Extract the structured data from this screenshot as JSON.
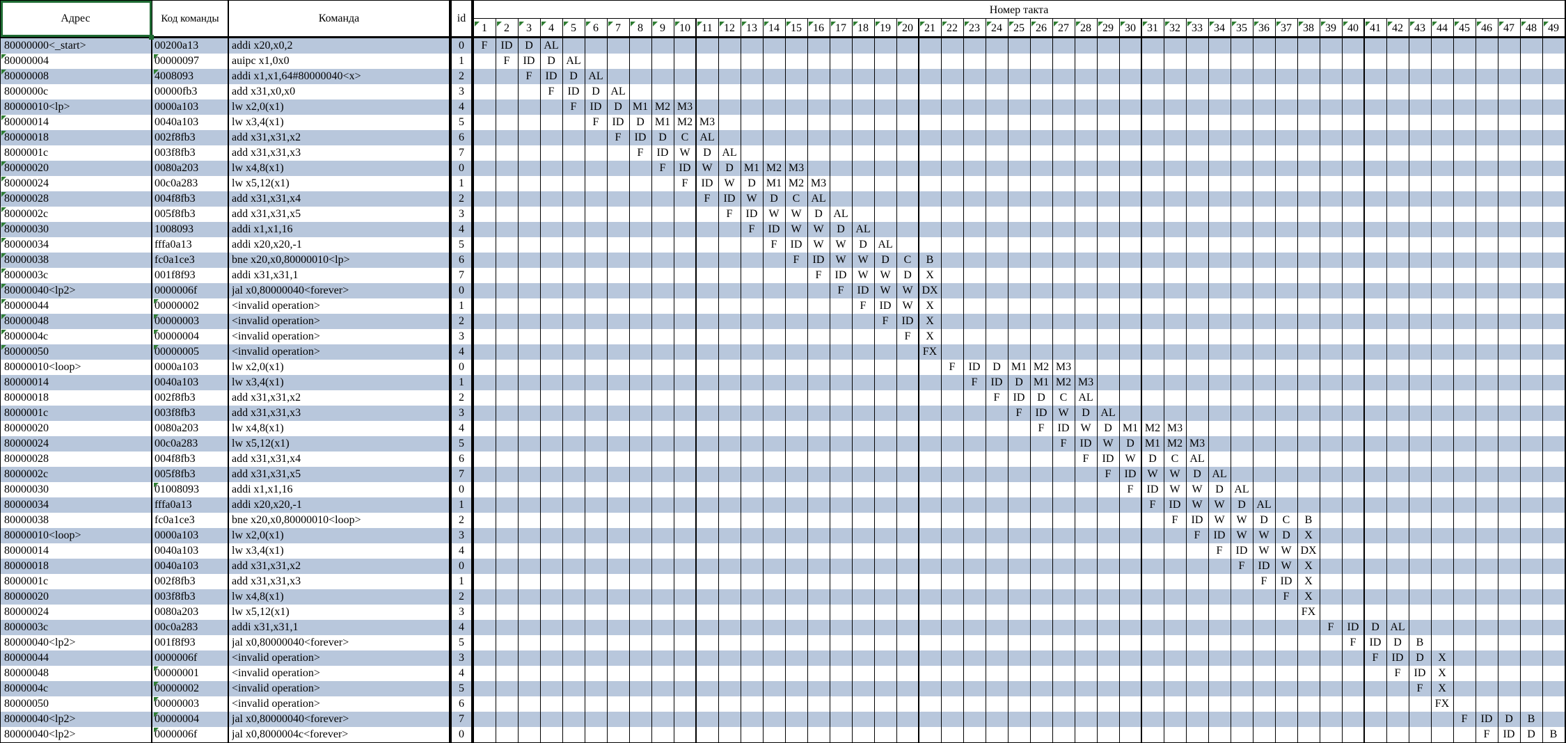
{
  "headers": {
    "address": "Адрес",
    "code": "Код команды",
    "command": "Команда",
    "id": "id",
    "clock": "Номер такта"
  },
  "cycles": [
    "1",
    "2",
    "3",
    "4",
    "5",
    "6",
    "7",
    "8",
    "9",
    "10",
    "11",
    "12",
    "13",
    "14",
    "15",
    "16",
    "17",
    "18",
    "19",
    "20",
    "21",
    "22",
    "23",
    "24",
    "25",
    "26",
    "27",
    "28",
    "29",
    "30",
    "31",
    "32",
    "33",
    "34",
    "35",
    "36",
    "37",
    "38",
    "39",
    "40",
    "41",
    "42",
    "43",
    "44",
    "45",
    "46",
    "47",
    "48",
    "49"
  ],
  "colors": {
    "band": "#b8c7dc",
    "grid_line": "#000000",
    "comment_marker": "#2e7d32",
    "selection": "#1f6b33"
  },
  "rows": [
    {
      "addr": "80000000<_start>",
      "code": "00200a13",
      "cmd": "addi x20,x0,2",
      "id": "0",
      "start": 1,
      "stages": [
        "F",
        "ID",
        "D",
        "AL"
      ]
    },
    {
      "addr": "80000004",
      "code": "00000097",
      "cmd": "auipc x1,0x0",
      "id": "1",
      "start": 2,
      "stages": [
        "F",
        "ID",
        "D",
        "AL"
      ]
    },
    {
      "addr": "80000008",
      "code": "4008093",
      "cmd": "addi x1,x1,64#80000040<x>",
      "id": "2",
      "start": 3,
      "stages": [
        "F",
        "ID",
        "D",
        "AL"
      ]
    },
    {
      "addr": "8000000c",
      "code": "00000fb3",
      "cmd": "add x31,x0,x0",
      "id": "3",
      "start": 4,
      "stages": [
        "F",
        "ID",
        "D",
        "AL"
      ]
    },
    {
      "addr": "80000010<lp>",
      "code": "0000a103",
      "cmd": "lw x2,0(x1)",
      "id": "4",
      "start": 5,
      "stages": [
        "F",
        "ID",
        "D",
        "M1",
        "M2",
        "M3"
      ]
    },
    {
      "addr": "80000014",
      "code": "0040a103",
      "cmd": "lw x3,4(x1)",
      "id": "5",
      "start": 6,
      "stages": [
        "F",
        "ID",
        "D",
        "M1",
        "M2",
        "M3"
      ]
    },
    {
      "addr": "80000018",
      "code": "002f8fb3",
      "cmd": "add x31,x31,x2",
      "id": "6",
      "start": 7,
      "stages": [
        "F",
        "ID",
        "D",
        "C",
        "AL"
      ]
    },
    {
      "addr": "8000001c",
      "code": "003f8fb3",
      "cmd": "add x31,x31,x3",
      "id": "7",
      "start": 8,
      "stages": [
        "F",
        "ID",
        "W",
        "D",
        "AL"
      ]
    },
    {
      "addr": "80000020",
      "code": "0080a203",
      "cmd": "lw x4,8(x1)",
      "id": "0",
      "start": 9,
      "stages": [
        "F",
        "ID",
        "W",
        "D",
        "M1",
        "M2",
        "M3"
      ]
    },
    {
      "addr": "80000024",
      "code": "00c0a283",
      "cmd": "lw x5,12(x1)",
      "id": "1",
      "start": 10,
      "stages": [
        "F",
        "ID",
        "W",
        "D",
        "M1",
        "M2",
        "M3"
      ]
    },
    {
      "addr": "80000028",
      "code": "004f8fb3",
      "cmd": "add x31,x31,x4",
      "id": "2",
      "start": 11,
      "stages": [
        "F",
        "ID",
        "W",
        "D",
        "C",
        "AL"
      ]
    },
    {
      "addr": "8000002c",
      "code": "005f8fb3",
      "cmd": "add x31,x31,x5",
      "id": "3",
      "start": 12,
      "stages": [
        "F",
        "ID",
        "W",
        "W",
        "D",
        "AL"
      ]
    },
    {
      "addr": "80000030",
      "code": "1008093",
      "cmd": "addi x1,x1,16",
      "id": "4",
      "start": 13,
      "stages": [
        "F",
        "ID",
        "W",
        "W",
        "D",
        "AL"
      ]
    },
    {
      "addr": "80000034",
      "code": "fffa0a13",
      "cmd": "addi x20,x20,-1",
      "id": "5",
      "start": 14,
      "stages": [
        "F",
        "ID",
        "W",
        "W",
        "D",
        "AL"
      ]
    },
    {
      "addr": "80000038",
      "code": "fc0a1ce3",
      "cmd": "bne x20,x0,80000010<lp>",
      "id": "6",
      "start": 15,
      "stages": [
        "F",
        "ID",
        "W",
        "W",
        "D",
        "C",
        "B"
      ]
    },
    {
      "addr": "8000003c",
      "code": "001f8f93",
      "cmd": "addi x31,x31,1",
      "id": "7",
      "start": 16,
      "stages": [
        "F",
        "ID",
        "W",
        "W",
        "D",
        "X"
      ]
    },
    {
      "addr": "80000040<lp2>",
      "code": "0000006f",
      "cmd": "jal x0,80000040<forever>",
      "id": "0",
      "start": 17,
      "stages": [
        "F",
        "ID",
        "W",
        "W",
        "DX"
      ]
    },
    {
      "addr": "80000044",
      "code": "00000002",
      "cmd": "<invalid operation>",
      "id": "1",
      "start": 18,
      "stages": [
        "F",
        "ID",
        "W",
        "X"
      ]
    },
    {
      "addr": "80000048",
      "code": "00000003",
      "cmd": "<invalid operation>",
      "id": "2",
      "start": 19,
      "stages": [
        "F",
        "ID",
        "X"
      ]
    },
    {
      "addr": "8000004c",
      "code": "00000004",
      "cmd": "<invalid operation>",
      "id": "3",
      "start": 20,
      "stages": [
        "F",
        "X"
      ]
    },
    {
      "addr": "80000050",
      "code": "00000005",
      "cmd": "<invalid operation>",
      "id": "4",
      "start": 21,
      "stages": [
        "FX"
      ]
    },
    {
      "addr": "80000010<loop>",
      "code": "0000a103",
      "cmd": "lw x2,0(x1)",
      "id": "0",
      "start": 22,
      "stages": [
        "F",
        "ID",
        "D",
        "M1",
        "M2",
        "M3"
      ]
    },
    {
      "addr": "80000014",
      "code": "0040a103",
      "cmd": "lw x3,4(x1)",
      "id": "1",
      "start": 23,
      "stages": [
        "F",
        "ID",
        "D",
        "M1",
        "M2",
        "M3"
      ]
    },
    {
      "addr": "80000018",
      "code": "002f8fb3",
      "cmd": "add x31,x31,x2",
      "id": "2",
      "start": 24,
      "stages": [
        "F",
        "ID",
        "D",
        "C",
        "AL"
      ]
    },
    {
      "addr": "8000001c",
      "code": "003f8fb3",
      "cmd": "add x31,x31,x3",
      "id": "3",
      "start": 25,
      "stages": [
        "F",
        "ID",
        "W",
        "D",
        "AL"
      ]
    },
    {
      "addr": "80000020",
      "code": "0080a203",
      "cmd": "lw x4,8(x1)",
      "id": "4",
      "start": 26,
      "stages": [
        "F",
        "ID",
        "W",
        "D",
        "M1",
        "M2",
        "M3"
      ]
    },
    {
      "addr": "80000024",
      "code": "00c0a283",
      "cmd": "lw x5,12(x1)",
      "id": "5",
      "start": 27,
      "stages": [
        "F",
        "ID",
        "W",
        "D",
        "M1",
        "M2",
        "M3"
      ]
    },
    {
      "addr": "80000028",
      "code": "004f8fb3",
      "cmd": "add x31,x31,x4",
      "id": "6",
      "start": 28,
      "stages": [
        "F",
        "ID",
        "W",
        "D",
        "C",
        "AL"
      ]
    },
    {
      "addr": "8000002c",
      "code": "005f8fb3",
      "cmd": "add x31,x31,x5",
      "id": "7",
      "start": 29,
      "stages": [
        "F",
        "ID",
        "W",
        "W",
        "D",
        "AL"
      ]
    },
    {
      "addr": "80000030",
      "code": "01008093",
      "cmd": "addi x1,x1,16",
      "id": "0",
      "start": 30,
      "stages": [
        "F",
        "ID",
        "W",
        "W",
        "D",
        "AL"
      ]
    },
    {
      "addr": "80000034",
      "code": "fffa0a13",
      "cmd": "addi x20,x20,-1",
      "id": "1",
      "start": 31,
      "stages": [
        "F",
        "ID",
        "W",
        "W",
        "D",
        "AL"
      ]
    },
    {
      "addr": "80000038",
      "code": "fc0a1ce3",
      "cmd": "bne x20,x0,80000010<loop>",
      "id": "2",
      "start": 32,
      "stages": [
        "F",
        "ID",
        "W",
        "W",
        "D",
        "C",
        "B"
      ]
    },
    {
      "addr": "80000010<loop>",
      "code": "0000a103",
      "cmd": "lw x2,0(x1)",
      "id": "3",
      "start": 33,
      "stages": [
        "F",
        "ID",
        "W",
        "W",
        "D",
        "X"
      ]
    },
    {
      "addr": "80000014",
      "code": "0040a103",
      "cmd": "lw x3,4(x1)",
      "id": "4",
      "start": 34,
      "stages": [
        "F",
        "ID",
        "W",
        "W",
        "DX"
      ]
    },
    {
      "addr": "80000018",
      "code": "0040a103",
      "cmd": "add x31,x31,x2",
      "id": "0",
      "start": 35,
      "stages": [
        "F",
        "ID",
        "W",
        "X"
      ]
    },
    {
      "addr": "8000001c",
      "code": "002f8fb3",
      "cmd": "add x31,x31,x3",
      "id": "1",
      "start": 36,
      "stages": [
        "F",
        "ID",
        "X"
      ]
    },
    {
      "addr": "80000020",
      "code": "003f8fb3",
      "cmd": "lw x4,8(x1)",
      "id": "2",
      "start": 37,
      "stages": [
        "F",
        "X"
      ]
    },
    {
      "addr": "80000024",
      "code": "0080a203",
      "cmd": "lw x5,12(x1)",
      "id": "3",
      "start": 38,
      "stages": [
        "FX"
      ]
    },
    {
      "addr": "8000003c",
      "code": "00c0a283",
      "cmd": "addi x31,x31,1",
      "id": "4",
      "start": 39,
      "stages": [
        "F",
        "ID",
        "D",
        "AL"
      ]
    },
    {
      "addr": "80000040<lp2>",
      "code": "001f8f93",
      "cmd": "jal x0,80000040<forever>",
      "id": "5",
      "start": 40,
      "stages": [
        "F",
        "ID",
        "D",
        "B"
      ]
    },
    {
      "addr": "80000044",
      "code": "0000006f",
      "cmd": "<invalid operation>",
      "id": "3",
      "start": 41,
      "stages": [
        "F",
        "ID",
        "D",
        "X"
      ]
    },
    {
      "addr": "80000048",
      "code": "00000001",
      "cmd": "<invalid operation>",
      "id": "4",
      "start": 42,
      "stages": [
        "F",
        "ID",
        "X"
      ]
    },
    {
      "addr": "8000004c",
      "code": "00000002",
      "cmd": "<invalid operation>",
      "id": "5",
      "start": 43,
      "stages": [
        "F",
        "X"
      ]
    },
    {
      "addr": "80000050",
      "code": "00000003",
      "cmd": "<invalid operation>",
      "id": "6",
      "start": 44,
      "stages": [
        "FX"
      ]
    },
    {
      "addr": "80000040<lp2>",
      "code": "00000004",
      "cmd": "jal x0,80000040<forever>",
      "id": "7",
      "start": 45,
      "stages": [
        "F",
        "ID",
        "D",
        "B"
      ]
    },
    {
      "addr": "80000040<lp2>",
      "code": "0000006f",
      "cmd": "jal x0,8000004c<forever>",
      "id": "0",
      "start": 46,
      "stages": [
        "F",
        "ID",
        "D",
        "B"
      ]
    }
  ],
  "comment_markers": {
    "addr_rows": [
      1,
      2,
      5,
      6,
      8,
      9,
      10,
      11,
      12,
      13,
      14,
      15,
      16,
      17,
      18,
      19,
      20
    ],
    "code_rows": [
      1,
      2,
      17,
      18,
      19,
      20,
      29,
      41,
      42,
      43,
      44,
      45
    ]
  }
}
